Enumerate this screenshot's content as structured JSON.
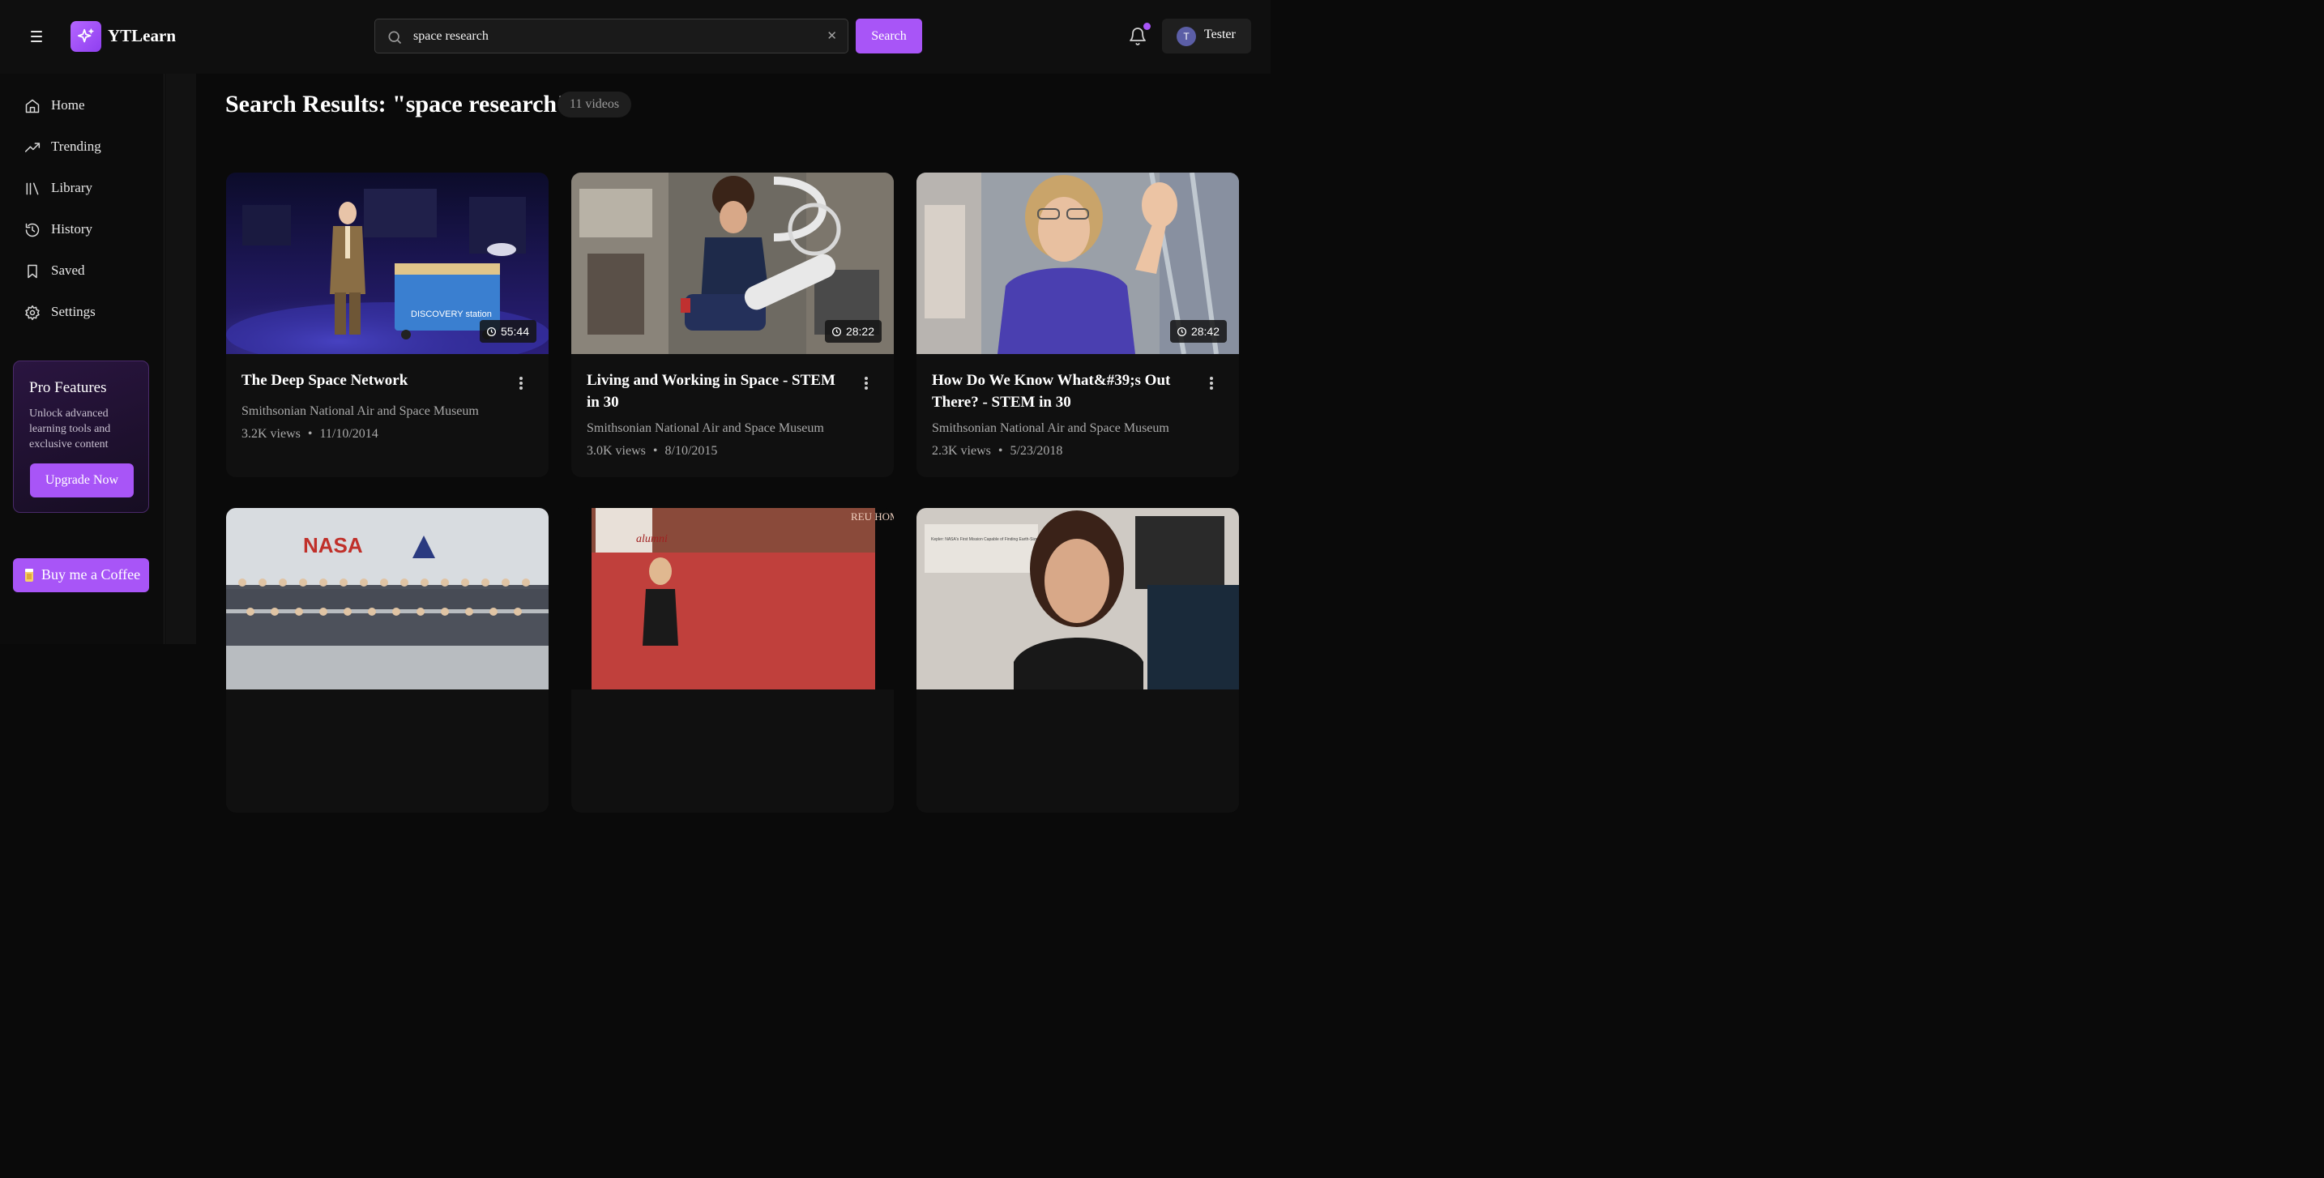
{
  "app": {
    "name": "YTLearn"
  },
  "search": {
    "value": "space research",
    "placeholder": "",
    "button_label": "Search",
    "clear_glyph": "✕"
  },
  "user": {
    "initial": "T",
    "name": "Tester"
  },
  "sidebar": {
    "items": [
      {
        "label": "Home",
        "icon": "home-icon"
      },
      {
        "label": "Trending",
        "icon": "trending-icon"
      },
      {
        "label": "Library",
        "icon": "library-icon"
      },
      {
        "label": "History",
        "icon": "history-icon"
      },
      {
        "label": "Saved",
        "icon": "bookmark-icon"
      },
      {
        "label": "Settings",
        "icon": "settings-icon"
      }
    ],
    "pro": {
      "title": "Pro Features",
      "description": "Unlock advanced learning tools and exclusive content",
      "button_label": "Upgrade Now"
    },
    "coffee_label": "Buy me a Coffee"
  },
  "results": {
    "title": "Search Results: \"space research\"",
    "count_label": "11 videos",
    "videos": [
      {
        "title": "The Deep Space Network",
        "channel": "Smithsonian National Air and Space Museum",
        "views": "3.2K views",
        "date": "11/10/2014",
        "duration": "55:44"
      },
      {
        "title": "Living and Working in Space - STEM in 30",
        "channel": "Smithsonian National Air and Space Museum",
        "views": "3.0K views",
        "date": "8/10/2015",
        "duration": "28:22"
      },
      {
        "title": "How Do We Know What&#39;s Out There? - STEM in 30",
        "channel": "Smithsonian National Air and Space Museum",
        "views": "2.3K views",
        "date": "5/23/2018",
        "duration": "28:42"
      },
      {
        "title": "",
        "channel": "",
        "views": "",
        "date": "",
        "duration": ""
      },
      {
        "title": "",
        "channel": "",
        "views": "",
        "date": "",
        "duration": ""
      },
      {
        "title": "",
        "channel": "",
        "views": "",
        "date": "",
        "duration": ""
      }
    ],
    "thumbnail_text": {
      "v1_cart": "DISCOVERY station",
      "v4_logo": "NASA",
      "v5_banner": "alumni",
      "v5_corner": "REU HOME",
      "v6_poster": "Kepler: NASA's First Mission Capable of Finding Earth-Size and Smaller Planets"
    }
  },
  "colors": {
    "accent": "#a855f7",
    "background": "#0a0a0a",
    "card": "#101010",
    "notification_dot": "#a855f7"
  }
}
